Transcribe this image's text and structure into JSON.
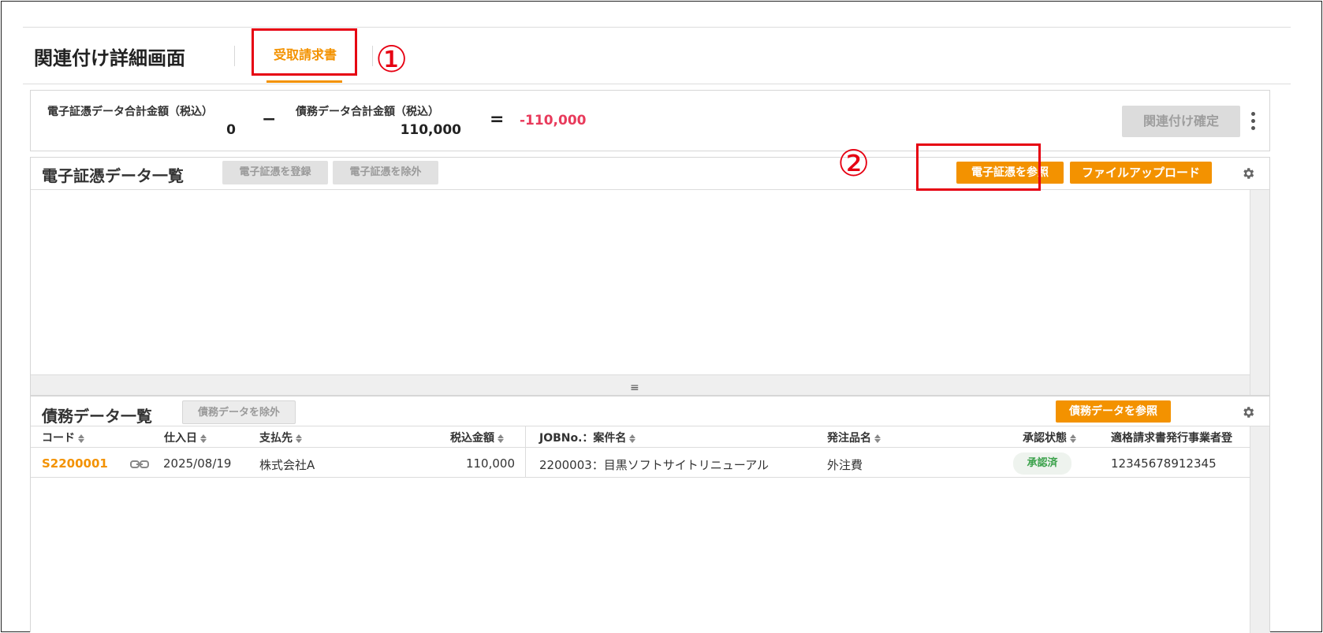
{
  "header": {
    "page_title": "関連付け詳細画面",
    "tab_label": "受取請求書"
  },
  "annotations": {
    "one": "①",
    "two": "②"
  },
  "summary": {
    "evidence_total_label": "電子証憑データ合計金額（税込）",
    "evidence_total_value": "0",
    "minus": "−",
    "debt_total_label": "債務データ合計金額（税込）",
    "debt_total_value": "110,000",
    "equals": "=",
    "difference_value": "-110,000",
    "confirm_label": "関連付け確定"
  },
  "evidence_section": {
    "title": "電子証憑データ一覧",
    "register_label": "電子証憑を登録",
    "exclude_label": "電子証憑を除外",
    "browse_label": "電子証憑を参照",
    "upload_label": "ファイルアップロード"
  },
  "splitter": "≡",
  "debt_section": {
    "title": "債務データ一覧",
    "exclude_label": "債務データを除外",
    "browse_label": "債務データを参照",
    "columns": [
      "コード",
      "仕入日",
      "支払先",
      "税込金額",
      "JOBNo.：案件名",
      "発注品名",
      "承認状態",
      "適格請求書発行事業者登"
    ],
    "rows": [
      {
        "code": "S2200001",
        "date": "2025/08/19",
        "payee": "株式会社A",
        "amount": "110,000",
        "job": "2200003：目黒ソフトサイトリニューアル",
        "item": "外注費",
        "status": "承認済",
        "registration": "12345678912345"
      }
    ]
  },
  "colors": {
    "accent": "#f39200",
    "negative": "#e83a5b",
    "annotation": "#e60012",
    "approved": "#3aa14a"
  }
}
